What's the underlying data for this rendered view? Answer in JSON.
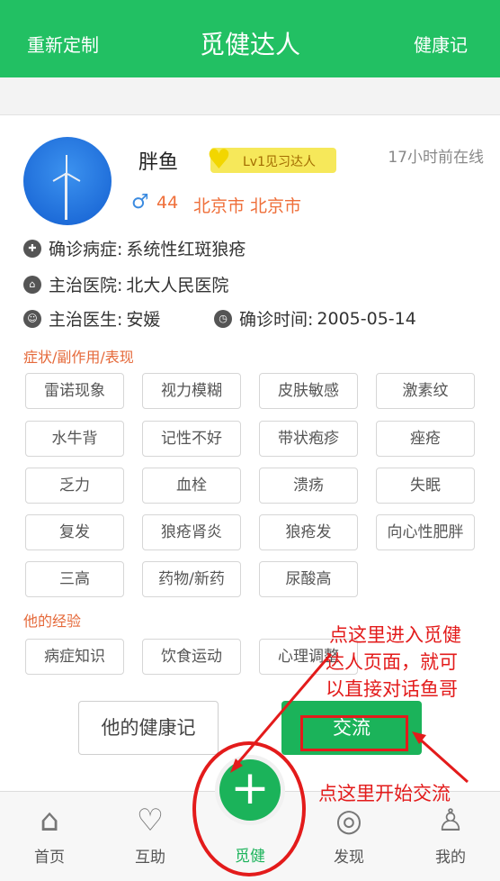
{
  "header": {
    "left": "重新定制",
    "title": "觅健达人",
    "right": "健康记"
  },
  "profile": {
    "name": "胖鱼",
    "level": "Lv1见习达人",
    "online": "17小时前在线",
    "gender_icon": "♂",
    "age": "44",
    "city": "北京市 北京市"
  },
  "info": {
    "disease_label": "确诊病症:",
    "disease": "系统性红斑狼疮",
    "hospital_label": "主治医院:",
    "hospital": "北大人民医院",
    "doctor_label": "主治医生:",
    "doctor": "安媛",
    "date_label": "确诊时间:",
    "date": "2005-05-14"
  },
  "symptoms": {
    "title": "症状/副作用/表现",
    "tags": [
      "雷诺现象",
      "视力模糊",
      "皮肤敏感",
      "激素纹",
      "水牛背",
      "记性不好",
      "带状疱疹",
      "痤疮",
      "乏力",
      "血栓",
      "溃疡",
      "失眠",
      "复发",
      "狼疮肾炎",
      "狼疮发",
      "向心性肥胖",
      "三高",
      "药物/新药",
      "尿酸高"
    ]
  },
  "experience": {
    "title": "他的经验",
    "tags": [
      "病症知识",
      "饮食运动",
      "心理调整"
    ]
  },
  "buttons": {
    "record": "他的健康记",
    "chat": "交流"
  },
  "tabbar": {
    "home": "首页",
    "help": "互助",
    "center": "觅健",
    "discover": "发现",
    "mine": "我的"
  },
  "annotations": {
    "text1": [
      "点这里进入觅健",
      "达人页面，就可",
      "以直接对话鱼哥"
    ],
    "text2": "点这里开始交流"
  },
  "colors": {
    "primary": "#22c063",
    "accent": "#e5693a",
    "annotation": "#e31b1b"
  }
}
